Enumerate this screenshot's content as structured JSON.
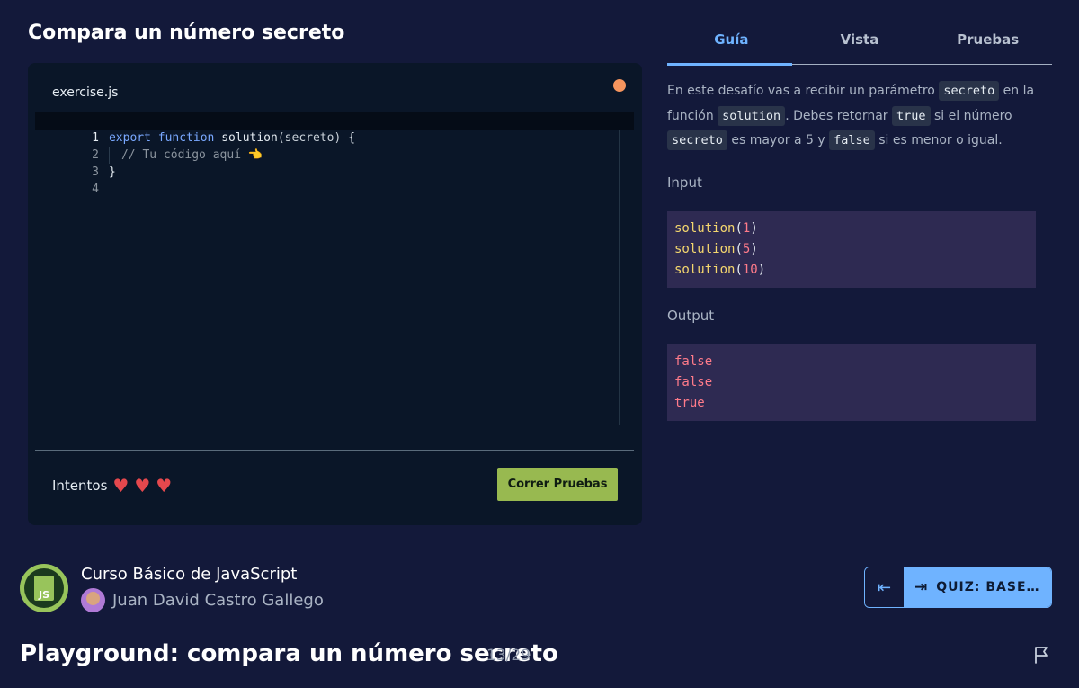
{
  "exercise": {
    "title": "Compara un número secreto"
  },
  "editor": {
    "filename": "exercise.js",
    "lines": [
      {
        "num": "1",
        "kw1": "export",
        "kw2": "function",
        "fn": "solution",
        "params": "(secreto)",
        "brace": " {"
      },
      {
        "num": "2",
        "comment": "// Tu código aquí 👈"
      },
      {
        "num": "3",
        "text": "}"
      },
      {
        "num": "4",
        "text": ""
      }
    ],
    "attempts_label": "Intentos",
    "hearts": [
      "heart",
      "heart",
      "heart"
    ],
    "run_button": "Correr Pruebas"
  },
  "tabs": [
    {
      "label": "Guía",
      "active": true
    },
    {
      "label": "Vista",
      "active": false
    },
    {
      "label": "Pruebas",
      "active": false
    }
  ],
  "guide": {
    "p1": "En este desafío vas a recibir un parámetro",
    "c1": "secreto",
    "p2": "en la función",
    "c2": "solution",
    "p3": ". Debes retornar",
    "c3": "true",
    "p4": "si el número",
    "c4": "secreto",
    "p5": "es mayor a 5 y",
    "c5": "false",
    "p6": "si es menor o igual."
  },
  "input": {
    "label": "Input",
    "calls": [
      {
        "fn": "solution",
        "arg": "1"
      },
      {
        "fn": "solution",
        "arg": "5"
      },
      {
        "fn": "solution",
        "arg": "10"
      }
    ]
  },
  "output": {
    "label": "Output",
    "values": [
      "false",
      "false",
      "true"
    ]
  },
  "course": {
    "logo_text": "JS",
    "name": "Curso Básico de JavaScript",
    "teacher": "Juan David Castro Gallego"
  },
  "nav": {
    "prev_icon": "⇤",
    "next_icon": "⇥",
    "next_label": "QUIZ: BASE…"
  },
  "class": {
    "title": "Playground: compara un número secreto",
    "progress": "13/29"
  },
  "colors": {
    "background": "#13193a",
    "editor_bg": "#0a1628",
    "accent": "#6fb3ff",
    "run_button": "#98b950",
    "status_dot": "#f6955e",
    "heart": "#e5484d"
  }
}
